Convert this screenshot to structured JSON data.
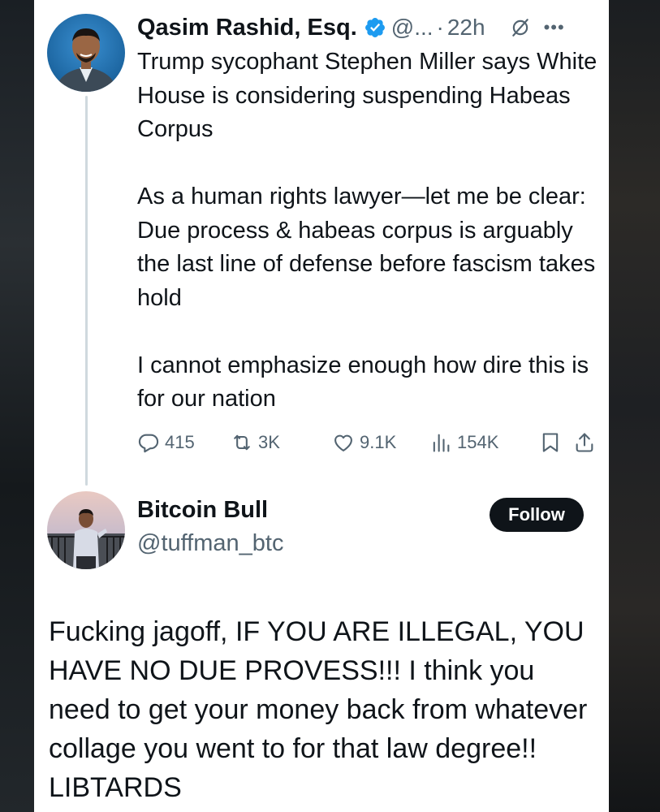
{
  "tweet": {
    "author": {
      "display_name": "Qasim Rashid, Esq.",
      "handle": "@...",
      "separator": "·",
      "time": "22h",
      "avatar": "profile-photo-man-suit"
    },
    "paragraphs": [
      "Trump sycophant Stephen Miller says White House is considering suspending Habeas Corpus",
      "As a human rights lawyer—let me be clear: Due process & habeas corpus is arguably the last line of defense before fascism takes hold",
      "I cannot emphasize enough how dire this is for our nation"
    ],
    "stats": {
      "replies": "415",
      "reposts": "3K",
      "likes": "9.1K",
      "views": "154K"
    },
    "icons": [
      "verified-badge-icon",
      "grok-icon",
      "more-icon",
      "reply-icon",
      "repost-icon",
      "like-icon",
      "views-icon",
      "bookmark-icon",
      "share-icon"
    ]
  },
  "reply": {
    "author": {
      "display_name": "Bitcoin Bull",
      "handle": "@tuffman_btc",
      "avatar": "profile-photo-man-balcony"
    },
    "follow_label": "Follow",
    "text": "Fucking jagoff, IF YOU ARE ILLEGAL, YOU HAVE NO DUE PROVESS!!! I think you need to get your money back from whatever collage you went to for that law degree!! LIBTARDS"
  },
  "colors": {
    "text_primary": "#0f1419",
    "text_secondary": "#536471",
    "verified": "#1d9bf0",
    "thread_line": "#cfd9de",
    "follow_bg": "#0f1419"
  }
}
